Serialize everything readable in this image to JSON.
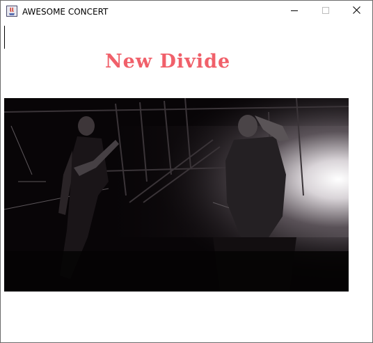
{
  "window": {
    "title": "AWESOME CONCERT",
    "icons": {
      "app": "java-coffee-icon",
      "minimize": "minimize-icon",
      "maximize": "maximize-icon",
      "close": "close-icon"
    }
  },
  "content": {
    "headline": "New Divide",
    "headline_color": "#f0606a",
    "image": "concert-photo"
  }
}
